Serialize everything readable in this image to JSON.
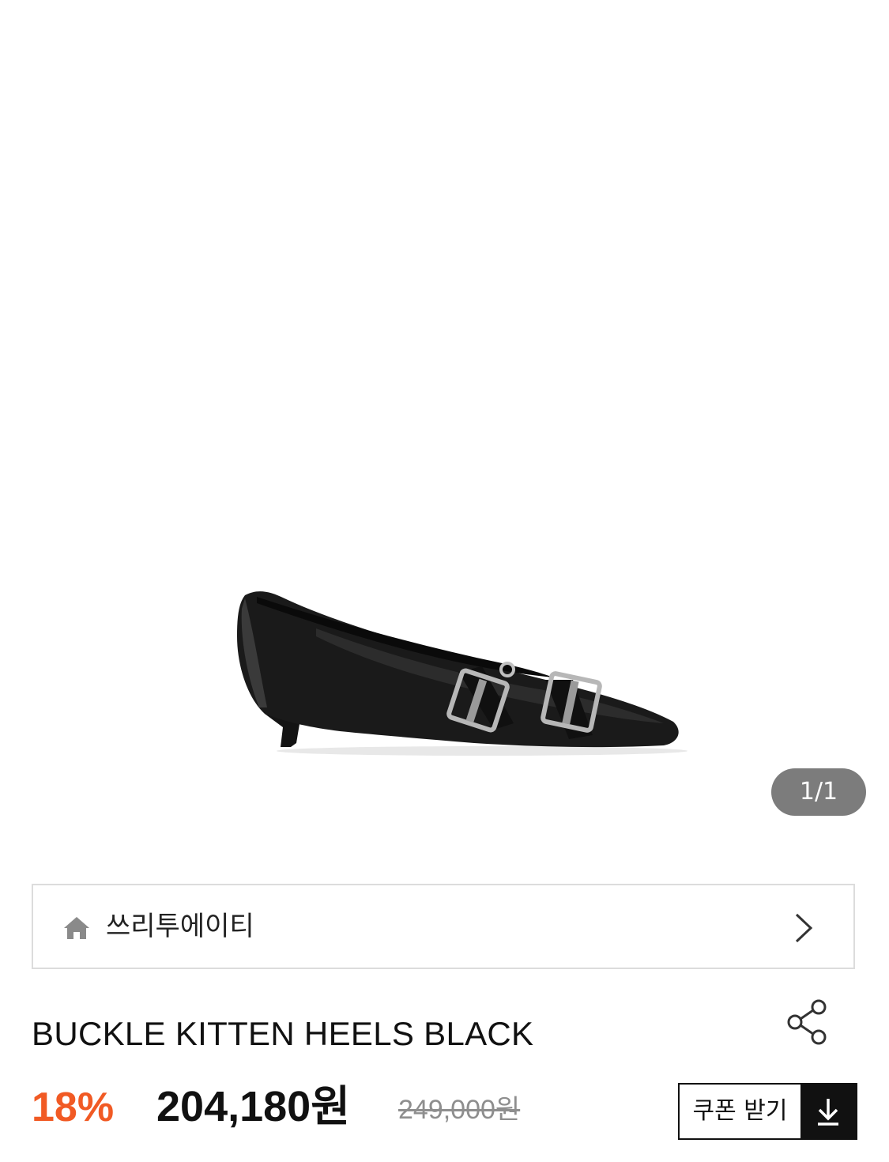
{
  "gallery": {
    "image_alt": "black buckle kitten heel shoe",
    "counter": "1/1"
  },
  "brand": {
    "name": "쓰리투에이티"
  },
  "product": {
    "title": "BUCKLE KITTEN HEELS BLACK",
    "discount": "18%",
    "price": "204,180원",
    "original_price": "249,000원"
  },
  "coupon": {
    "label": "쿠폰 받기"
  },
  "colors": {
    "accent": "#f15a24",
    "counter_bg": "#7c7c7c",
    "border": "#dcdcdc"
  }
}
